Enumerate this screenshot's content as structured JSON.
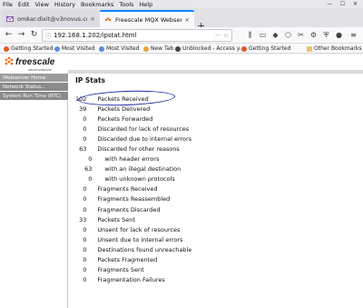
{
  "browser": {
    "menu": [
      "File",
      "Edit",
      "View",
      "History",
      "Bookmarks",
      "Tools",
      "Help"
    ],
    "window_controls": {
      "minimize": "—",
      "maximize": "☐",
      "close": "✕"
    },
    "tabs": [
      {
        "title": "omkar.dixit@v3novus.com - Y",
        "icon": "mail-icon",
        "active": false
      },
      {
        "title": "Freescale MQX Webserver",
        "icon": "freescale-favicon",
        "active": true
      }
    ],
    "new_tab": "+",
    "url": "192.168.1.202/ipstat.html",
    "url_more": "···",
    "url_bookmark": "☆",
    "bookmarks": [
      {
        "label": "Getting Started",
        "icon_color": "#e25a26"
      },
      {
        "label": "Most Visited",
        "icon_color": "#5a8fd8"
      },
      {
        "label": "Most Visited",
        "icon_color": "#5a8fd8"
      },
      {
        "label": "New Tab",
        "icon_color": "#e9a23b"
      },
      {
        "label": "Unblocked - Access y...",
        "icon_color": "#444444"
      },
      {
        "label": "Getting Started",
        "icon_color": "#e25a26"
      }
    ],
    "other_bookmarks": "Other Bookmarks"
  },
  "page": {
    "logo_text": "freescale",
    "logo_sub": "semiconductor",
    "sidebar": [
      "Webserver Home",
      "Network Status...",
      "System Run Time (RTC)"
    ],
    "title": "IP Stats",
    "stats": [
      {
        "value": "102",
        "label": "Packets Received",
        "indent": 0
      },
      {
        "value": "39",
        "label": "Packets Delivered",
        "indent": 0
      },
      {
        "value": "0",
        "label": "Packets Forwarded",
        "indent": 0
      },
      {
        "value": "0",
        "label": "Discarded for lack of resources",
        "indent": 0
      },
      {
        "value": "0",
        "label": "Discarded due to internal errors",
        "indent": 0
      },
      {
        "value": "63",
        "label": "Discarded for other reasons",
        "indent": 0
      },
      {
        "value": "0",
        "label": "with header errors",
        "indent": 1
      },
      {
        "value": "63",
        "label": "with an illegal destination",
        "indent": 1
      },
      {
        "value": "0",
        "label": "with unknown protocols",
        "indent": 1
      },
      {
        "value": "0",
        "label": "Fragments Received",
        "indent": 0
      },
      {
        "value": "0",
        "label": "Fragments Reassembled",
        "indent": 0
      },
      {
        "value": "0",
        "label": "Fragments Discarded",
        "indent": 0
      },
      {
        "value": "33",
        "label": "Packets Sent",
        "indent": 0
      },
      {
        "value": "0",
        "label": "Unsent for lack of resources",
        "indent": 0
      },
      {
        "value": "0",
        "label": "Unsent due to internal errors",
        "indent": 0
      },
      {
        "value": "0",
        "label": "Destinations found unreachable",
        "indent": 0
      },
      {
        "value": "0",
        "label": "Packets Fragmented",
        "indent": 0
      },
      {
        "value": "0",
        "label": "Fragments Sent",
        "indent": 0
      },
      {
        "value": "0",
        "label": "Fragmentation Failures",
        "indent": 0
      }
    ]
  },
  "colors": {
    "accent": "#0a84ff",
    "highlight_ring": "#1c2fa8",
    "sidebar": "#8a8a8a"
  }
}
